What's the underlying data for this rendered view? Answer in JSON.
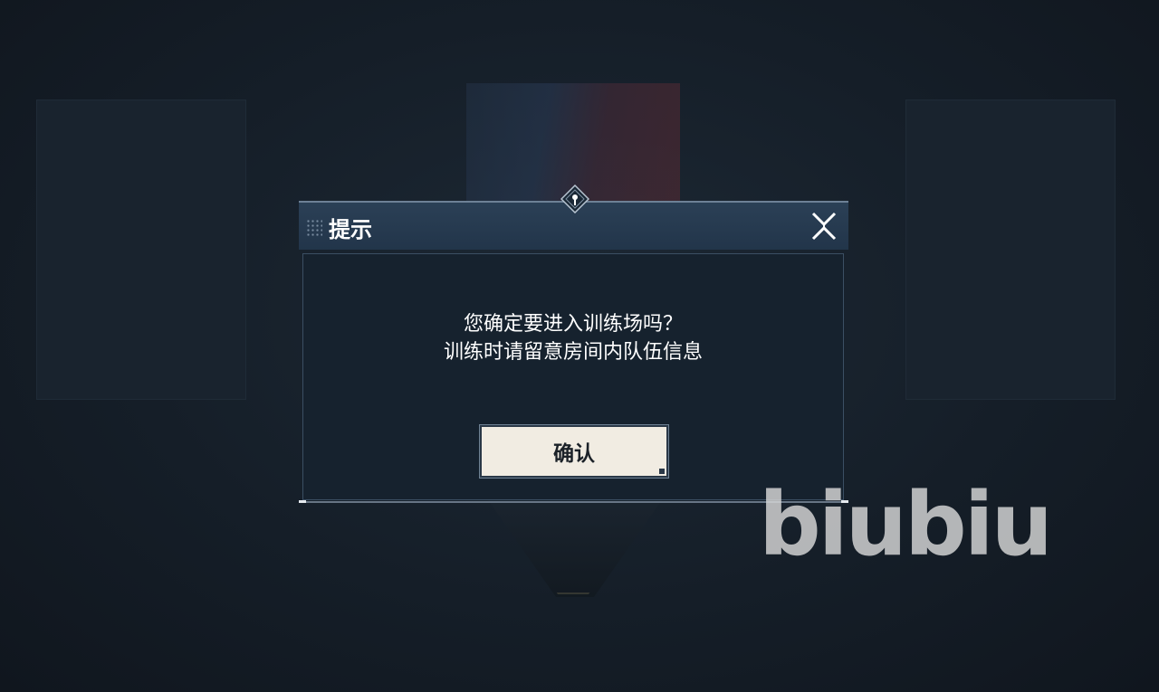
{
  "dialog": {
    "title": "提示",
    "message_line1": "您确定要进入训练场吗？",
    "message_line2": "训练时请留意房间内队伍信息",
    "confirm_label": "确认"
  },
  "watermark": {
    "text": "biubiu"
  },
  "icons": {
    "close": "close-x-icon",
    "grip": "drag-grip-icon",
    "ornament": "diamond-ornament-icon"
  },
  "colors": {
    "background": "#151d27",
    "header": "#2b4056",
    "body": "#16222e",
    "button": "#f1ece2",
    "text": "#ffffff"
  }
}
